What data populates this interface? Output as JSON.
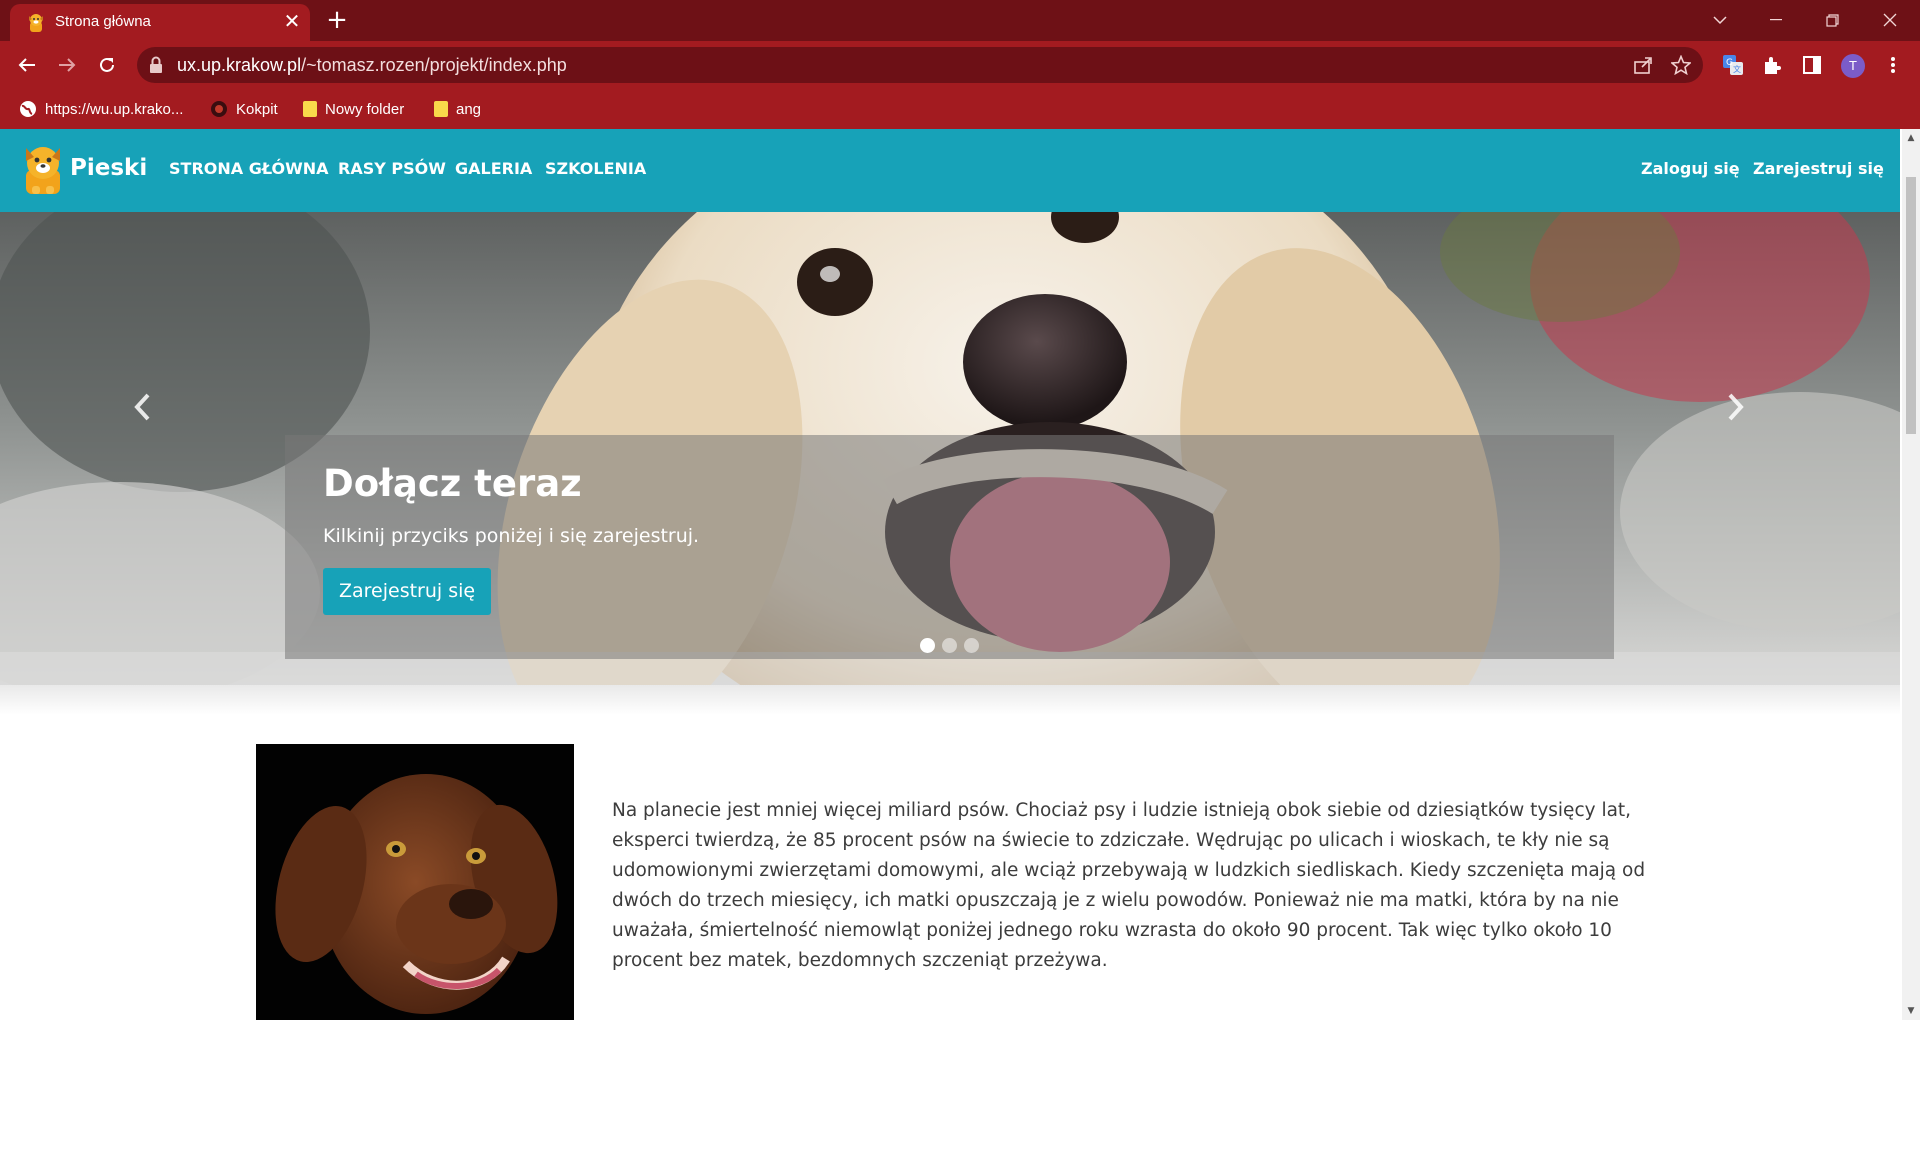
{
  "browser": {
    "tab_title": "Strona główna",
    "tab_close": "✕",
    "new_tab": "+",
    "url_host": "ux.up.krakow.pl",
    "url_path": "/~tomasz.rozen/projekt/index.php",
    "profile_initial": "T",
    "bookmarks": [
      {
        "label": "https://wu.up.krako...",
        "icon": "globe-icon"
      },
      {
        "label": "Kokpit",
        "icon": "bookmark-site-icon"
      },
      {
        "label": "Nowy folder",
        "icon": "folder-icon"
      },
      {
        "label": "ang",
        "icon": "folder-icon"
      }
    ],
    "colors": {
      "frame": "#6e1116",
      "toolbar": "#a31b20",
      "omnibox": "#6d1016"
    }
  },
  "site": {
    "brand": "Pieski",
    "nav": {
      "home": "STRONA GŁÓWNA",
      "breeds": "RASY PSÓW",
      "gallery": "GALERIA",
      "training": "SZKOLENIA",
      "login": "Zaloguj się",
      "register": "Zarejestruj się"
    },
    "colors": {
      "accent": "#17a2b8",
      "text": "#3c3c3c"
    }
  },
  "carousel": {
    "title": "Dołącz teraz",
    "text": "Kilkinij przyciks poniżej i się zarejestruj.",
    "button": "Zarejestruj się",
    "slide_count": 3,
    "active_slide": 1
  },
  "article": {
    "paragraph": "Na planecie jest mniej więcej miliard psów. Chociaż psy i ludzie istnieją obok siebie od dziesiątków tysięcy lat, eksperci twierdzą, że 85 procent psów na świecie to zdziczałe. Wędrując po ulicach i wioskach, te kły nie są udomowionymi zwierzętami domowymi, ale wciąż przebywają w ludzkich siedliskach. Kiedy szczenięta mają od dwóch do trzech miesięcy, ich matki opuszczają je z wielu powodów. Ponieważ nie ma matki, która by na nie uważała, śmiertelność niemowląt poniżej jednego roku wzrasta do około 90 procent. Tak więc tylko około 10 procent bez matek, bezdomnych szczeniąt przeżywa."
  }
}
